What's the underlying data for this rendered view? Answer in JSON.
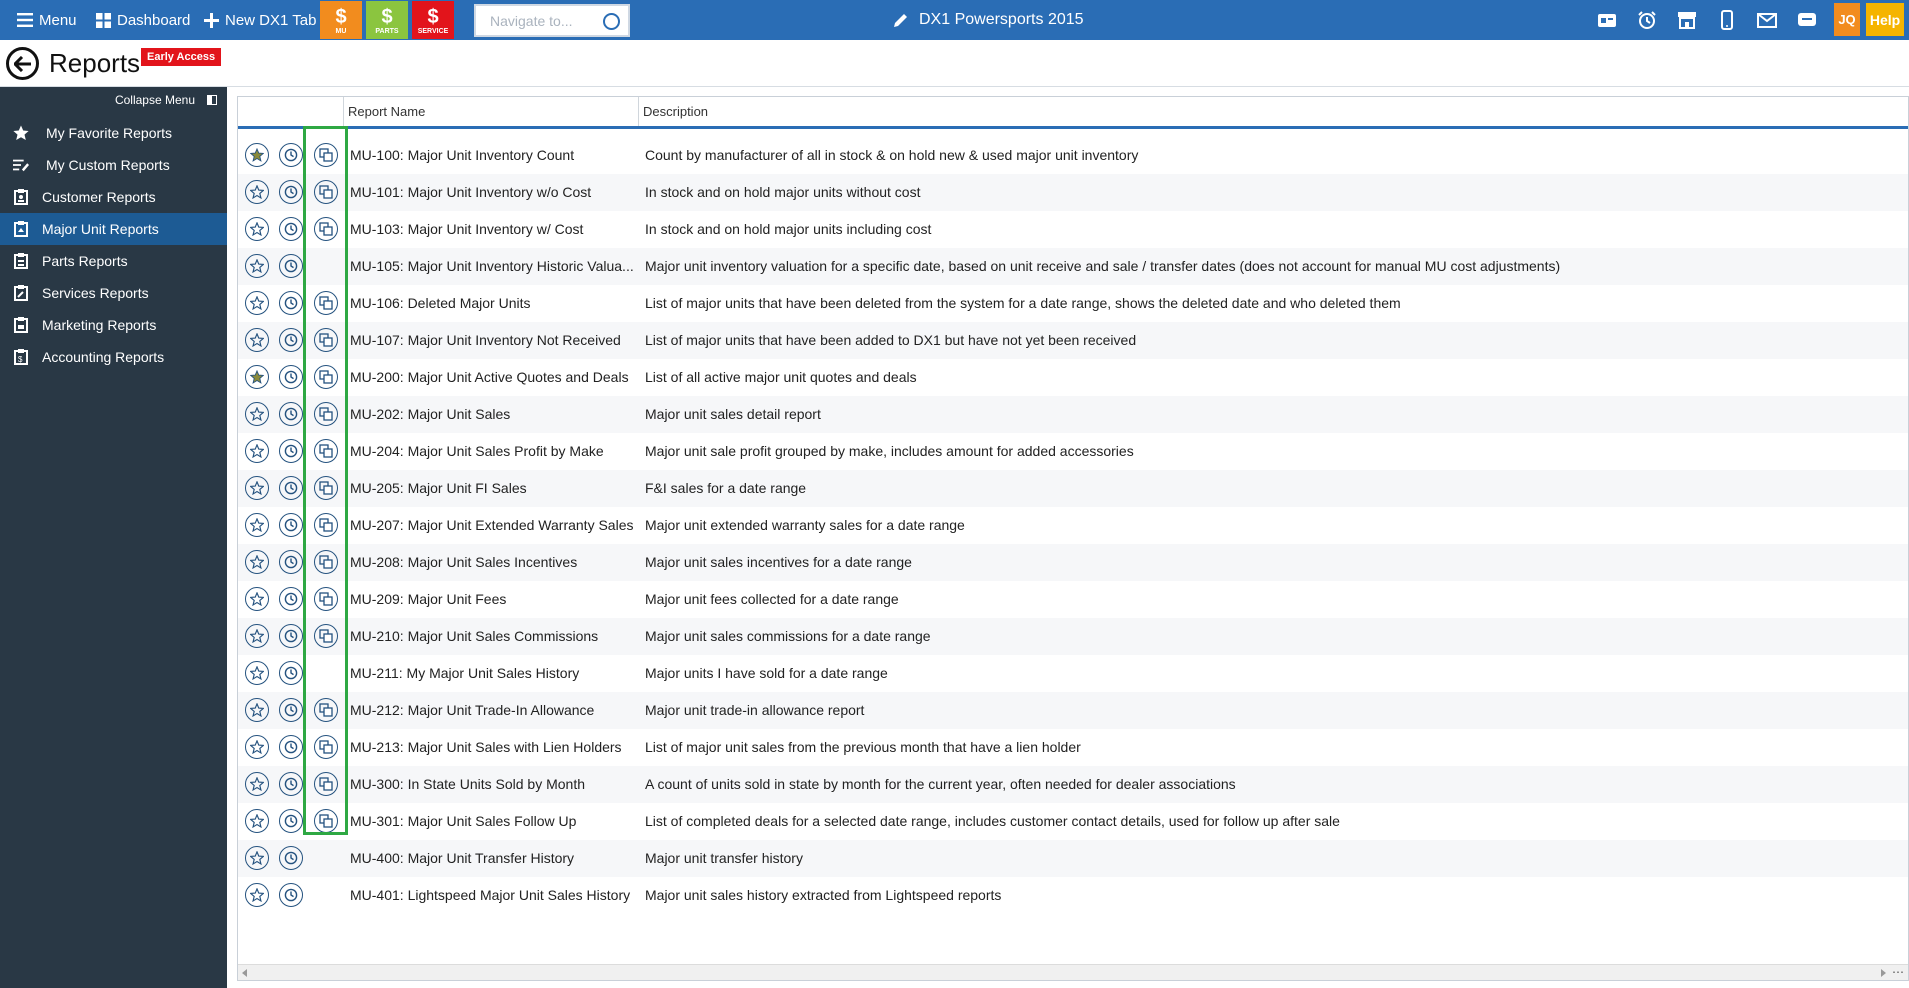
{
  "topbar": {
    "menu_label": "Menu",
    "dashboard_label": "Dashboard",
    "new_tab_label": "New DX1 Tab",
    "quick_buttons": [
      {
        "label": "MU",
        "color": "#f28c1e"
      },
      {
        "label": "PARTS",
        "color": "#8bc53f"
      },
      {
        "label": "SERVICE",
        "color": "#e2141b"
      }
    ],
    "navigate_placeholder": "Navigate to...",
    "app_title": "DX1 Powersports 2015",
    "user_initials": "JQ",
    "help_label": "Help",
    "right_icons": [
      "dealership-icon",
      "alarm-clock-icon",
      "store-icon",
      "mobile-icon",
      "mail-icon",
      "chat-icon"
    ]
  },
  "header": {
    "title": "Reports",
    "badge": "Early Access"
  },
  "sidebar": {
    "collapse_label": "Collapse Menu",
    "items": [
      {
        "label": "My Favorite Reports",
        "icon": "star-icon",
        "active": false
      },
      {
        "label": "My Custom Reports",
        "icon": "custom-report-icon",
        "active": false
      },
      {
        "label": "Customer Reports",
        "icon": "report-icon",
        "active": false
      },
      {
        "label": "Major Unit Reports",
        "icon": "report-icon",
        "active": true
      },
      {
        "label": "Parts Reports",
        "icon": "report-icon",
        "active": false
      },
      {
        "label": "Services Reports",
        "icon": "report-icon",
        "active": false
      },
      {
        "label": "Marketing Reports",
        "icon": "report-icon",
        "active": false
      },
      {
        "label": "Accounting Reports",
        "icon": "report-icon",
        "active": false
      }
    ]
  },
  "table": {
    "columns": [
      "Report Name",
      "Description"
    ],
    "rows": [
      {
        "name": "MU-100: Major Unit Inventory Count",
        "desc": "Count by manufacturer of all in stock & on hold new & used major unit inventory",
        "favorite": true,
        "copy": true
      },
      {
        "name": "MU-101: Major Unit Inventory w/o Cost",
        "desc": "In stock and on hold major units without cost",
        "favorite": false,
        "copy": true
      },
      {
        "name": "MU-103: Major Unit Inventory w/ Cost",
        "desc": "In stock and on hold major units including cost",
        "favorite": false,
        "copy": true
      },
      {
        "name": "MU-105: Major Unit Inventory Historic Valua...",
        "desc": "Major unit inventory valuation for a specific date, based on unit receive and sale / transfer dates (does not account for manual MU cost adjustments)",
        "favorite": false,
        "copy": false
      },
      {
        "name": "MU-106: Deleted Major Units",
        "desc": "List of major units that have been deleted from the system for a date range, shows the deleted date and who deleted them",
        "favorite": false,
        "copy": true
      },
      {
        "name": "MU-107: Major Unit Inventory Not Received",
        "desc": "List of major units that have been added to DX1 but have not yet been received",
        "favorite": false,
        "copy": true
      },
      {
        "name": "MU-200: Major Unit Active Quotes and Deals",
        "desc": "List of all active major unit quotes and deals",
        "favorite": true,
        "copy": true
      },
      {
        "name": "MU-202: Major Unit Sales",
        "desc": "Major unit sales detail report",
        "favorite": false,
        "copy": true
      },
      {
        "name": "MU-204: Major Unit Sales Profit by Make",
        "desc": "Major unit sale profit grouped by make, includes amount for added accessories",
        "favorite": false,
        "copy": true
      },
      {
        "name": "MU-205: Major Unit FI Sales",
        "desc": "F&I sales for a date range",
        "favorite": false,
        "copy": true
      },
      {
        "name": "MU-207: Major Unit Extended Warranty Sales",
        "desc": "Major unit extended warranty sales for a date range",
        "favorite": false,
        "copy": true
      },
      {
        "name": "MU-208: Major Unit Sales Incentives",
        "desc": "Major unit sales incentives for a date range",
        "favorite": false,
        "copy": true
      },
      {
        "name": "MU-209: Major Unit Fees",
        "desc": "Major unit fees collected for a date range",
        "favorite": false,
        "copy": true
      },
      {
        "name": "MU-210: Major Unit Sales Commissions",
        "desc": "Major unit sales commissions for a date range",
        "favorite": false,
        "copy": true
      },
      {
        "name": "MU-211: My Major Unit Sales History",
        "desc": "Major units I have sold for a date range",
        "favorite": false,
        "copy": false
      },
      {
        "name": "MU-212: Major Unit Trade-In Allowance",
        "desc": "Major unit trade-in allowance report",
        "favorite": false,
        "copy": true
      },
      {
        "name": "MU-213: Major Unit Sales with Lien Holders",
        "desc": "List of major unit sales from the previous month that have a lien holder",
        "favorite": false,
        "copy": true
      },
      {
        "name": "MU-300: In State Units Sold by Month",
        "desc": "A count of units sold in state by month for the current year, often needed for dealer associations",
        "favorite": false,
        "copy": true
      },
      {
        "name": "MU-301: Major Unit Sales Follow Up",
        "desc": "List of completed deals for a selected date range, includes customer contact details, used for follow up after sale",
        "favorite": false,
        "copy": true
      },
      {
        "name": "MU-400: Major Unit Transfer History",
        "desc": "Major unit transfer history",
        "favorite": false,
        "copy": false
      },
      {
        "name": "MU-401: Lightspeed Major Unit Sales History",
        "desc": "Major unit sales history extracted from Lightspeed reports",
        "favorite": false,
        "copy": false
      }
    ]
  },
  "colors": {
    "topbar": "#2a6db5",
    "sidebar": "#293845",
    "sidebar_active": "#1d5b94",
    "highlight": "#2ea843",
    "favorite_star": "#8a8a3a"
  }
}
